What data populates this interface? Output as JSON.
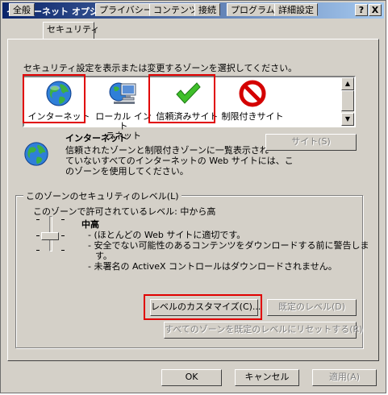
{
  "window": {
    "title": "インターネット オプション",
    "help_label": "?",
    "close_label": "X"
  },
  "tabs": [
    {
      "label": "全般"
    },
    {
      "label": "セキュリティ"
    },
    {
      "label": "プライバシー"
    },
    {
      "label": "コンテンツ"
    },
    {
      "label": "接続"
    },
    {
      "label": "プログラム"
    },
    {
      "label": "詳細設定"
    }
  ],
  "zones": {
    "prompt": "セキュリティ設定を表示または変更するゾーンを選択してください。",
    "items": [
      {
        "label": "インターネット",
        "icon": "globe-icon"
      },
      {
        "label": "ローカル イントラネット",
        "label_line1": "ローカル イント",
        "label_line2": "ラネット",
        "icon": "intranet-icon"
      },
      {
        "label": "信頼済みサイト",
        "icon": "checkmark-icon"
      },
      {
        "label": "制限付きサイト",
        "icon": "no-entry-icon"
      }
    ]
  },
  "selected_zone": {
    "name": "インターネット",
    "description_lines": [
      "信頼されたゾーンと制限付きゾーンに一覧表示され",
      "ていないすべてのインターネットの Web サイトには、こ",
      "のゾーンを使用してください。"
    ],
    "sites_button": "サイト(S)"
  },
  "security_level": {
    "group_title": "このゾーンのセキュリティのレベル(L)",
    "allowed": "このゾーンで許可されているレベル: 中から高",
    "level_name": "中高",
    "details": [
      "- (ほとんどの Web サイトに適切です。",
      "- 安全でない可能性のあるコンテンツをダウンロードする前に警告しま",
      "す。",
      "- 未署名の ActiveX コントロールはダウンロードされません。"
    ],
    "custom_button": "レベルのカスタマイズ(C)...",
    "default_button": "既定のレベル(D)",
    "reset_all_button": "すべてのゾーンを既定のレベルにリセットする(R)"
  },
  "footer": {
    "ok": "OK",
    "cancel": "キャンセル",
    "apply": "適用(A)"
  },
  "colors": {
    "highlight_box": "#e00000",
    "titlebar_start": "#0a246a",
    "titlebar_end": "#a6caf0"
  }
}
